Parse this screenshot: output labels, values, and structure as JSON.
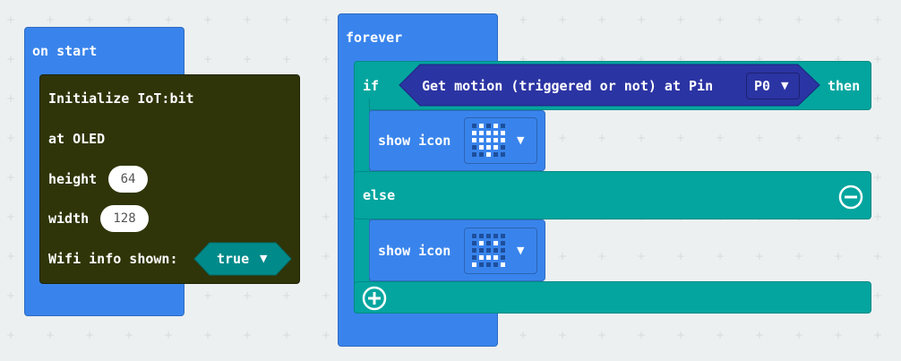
{
  "on_start": {
    "label": "on start",
    "iot_init": {
      "title": "Initialize IoT:bit",
      "at_label": "at OLED",
      "height_label": "height",
      "height_value": "64",
      "width_label": "width",
      "width_value": "128",
      "wifi_label": "Wifi info shown:",
      "wifi_value": "true"
    }
  },
  "forever": {
    "label": "forever",
    "if_label": "if",
    "condition_label": "Get motion (triggered or not) at Pin",
    "pin_value": "P0",
    "then_label": "then",
    "show_icon_1": {
      "label": "show icon",
      "icon": "heart"
    },
    "else_label": "else",
    "show_icon_2": {
      "label": "show icon",
      "icon": "sad-face"
    }
  },
  "colors": {
    "event_blue": "#3984ec",
    "iot_olive": "#2f3508",
    "logic_teal": "#04a59f",
    "condition_navy": "#2b34a3"
  },
  "icons": [
    "remove-circle-icon",
    "add-circle-icon",
    "dropdown-caret-icon"
  ]
}
